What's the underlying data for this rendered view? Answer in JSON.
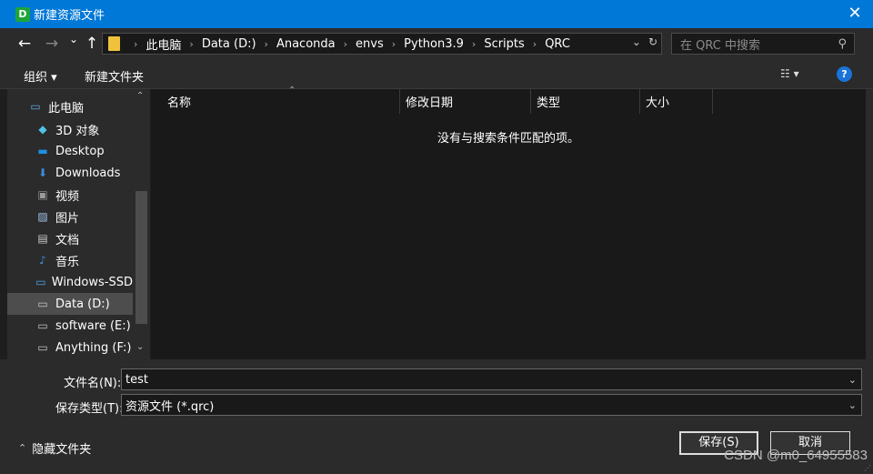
{
  "window": {
    "title": "新建资源文件",
    "app_icon_letter": "D",
    "close_glyph": "✕"
  },
  "address_bar": {
    "back_glyph": "←",
    "forward_glyph": "→",
    "recent_glyph": "⌄",
    "up_glyph": "↑",
    "breadcrumbs": [
      "此电脑",
      "Data (D:)",
      "Anaconda",
      "envs",
      "Python3.9",
      "Scripts",
      "QRC"
    ],
    "separator": "›",
    "dropdown_glyph": "⌄",
    "refresh_glyph": "↻"
  },
  "search": {
    "placeholder": "在 QRC 中搜索",
    "icon_glyph": "⚲"
  },
  "toolbar": {
    "organize_label": "组织 ▾",
    "new_folder_label": "新建文件夹",
    "view_glyph": "☷ ▾",
    "help_glyph": "?"
  },
  "nav_pane": {
    "items": [
      {
        "label": "此电脑",
        "icon": "computer-icon",
        "icon_color": "#5aa9e6"
      },
      {
        "label": "3D 对象",
        "icon": "3d-objects-icon",
        "icon_color": "#4fc3e8"
      },
      {
        "label": "Desktop",
        "icon": "desktop-icon",
        "icon_color": "#1e90e0"
      },
      {
        "label": "Downloads",
        "icon": "downloads-icon",
        "icon_color": "#3b8fe0"
      },
      {
        "label": "视频",
        "icon": "videos-icon",
        "icon_color": "#9a9a9a"
      },
      {
        "label": "图片",
        "icon": "pictures-icon",
        "icon_color": "#9ec3e6"
      },
      {
        "label": "文档",
        "icon": "documents-icon",
        "icon_color": "#c8c8c8"
      },
      {
        "label": "音乐",
        "icon": "music-icon",
        "icon_color": "#3b8fe0"
      },
      {
        "label": "Windows-SSD",
        "icon": "windows-drive-icon",
        "icon_color": "#4fa3e6"
      },
      {
        "label": "Data (D:)",
        "icon": "drive-icon",
        "icon_color": "#c8c8c8"
      },
      {
        "label": "software (E:)",
        "icon": "drive-icon",
        "icon_color": "#c8c8c8"
      },
      {
        "label": "Anything (F:)",
        "icon": "drive-icon",
        "icon_color": "#c8c8c8"
      }
    ],
    "selected_index": 9,
    "scroll_up_glyph": "⌃",
    "scroll_down_glyph": "⌄"
  },
  "file_list": {
    "columns": [
      "名称",
      "修改日期",
      "类型",
      "大小"
    ],
    "sort_glyph": "⌃",
    "empty_message": "没有与搜索条件匹配的项。"
  },
  "bottom": {
    "filename_label": "文件名(N):",
    "filename_value": "test",
    "filetype_label": "保存类型(T):",
    "filetype_value": "资源文件 (*.qrc)",
    "dropdown_glyph": "⌄",
    "hide_folders_label": "隐藏文件夹",
    "hide_folders_glyph": "⌃",
    "save_label": "保存(S)",
    "cancel_label": "取消",
    "watermark": "CSDN @m0_64955583"
  },
  "colors": {
    "titlebar": "#0078d7",
    "folder": "#f0c23b",
    "help": "#1a73d9"
  }
}
